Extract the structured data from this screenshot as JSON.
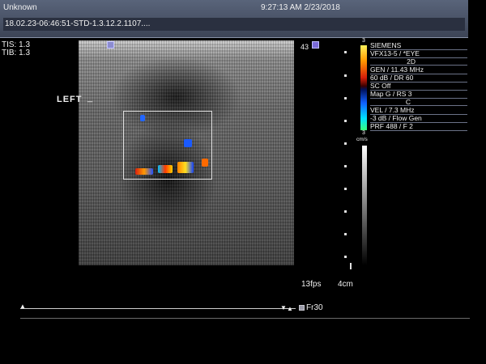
{
  "header": {
    "patient": "Unknown",
    "datetime": "9:27:13 AM 2/23/2018",
    "study_id": "18.02.23-06:46:51-STD-1.3.12.2.1107...."
  },
  "acoustic": {
    "tis": "TIS: 1.3",
    "tib": "TIB: 1.3"
  },
  "image": {
    "side_label": "LEFT",
    "side_marker": "_",
    "frame_number": "43"
  },
  "info_panel": {
    "lines": [
      "SIEMENS",
      "VFX13-5 / *EYE",
      "2D",
      "GEN / 11.43 MHz",
      "60 dB / DR 60",
      "SC Off",
      "Map G / RS 3",
      "C",
      "VEL / 7.3 MHz",
      "-3 dB / Flow Gen",
      "PRF 488 / F 2"
    ]
  },
  "colorbar": {
    "top_label": "3",
    "bottom_label": "3",
    "unit": "cm/s"
  },
  "status": {
    "fps": "13fps",
    "depth": "4cm",
    "frame": "Fr30"
  },
  "colors": {
    "header_bg": "#4a5368",
    "panel_divider": "#6b7287"
  }
}
